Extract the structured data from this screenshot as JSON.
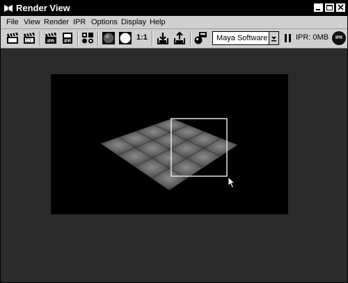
{
  "window": {
    "title": "Render View"
  },
  "menu": [
    "File",
    "View",
    "Render",
    "IPR",
    "Options",
    "Display",
    "Help"
  ],
  "toolbar": {
    "zoom_label": "1:1",
    "renderer": "Maya Software",
    "ipr_memory": "IPR: 0MB",
    "ipr_badge": "IPR",
    "icons": [
      "clapper-icon",
      "clapper-region-icon",
      "ipr-render-icon",
      "ipr-refresh-icon",
      "snapshot-icon",
      "color-sphere-icon",
      "alpha-sphere-icon",
      "keep-image-icon",
      "remove-image-icon",
      "render-globals-icon",
      "pause-icon"
    ]
  },
  "colors": {
    "titlebar": "#000000",
    "chrome": "#cfcfcf",
    "viewport": "#2b2b2b",
    "canvas": "#000000"
  }
}
